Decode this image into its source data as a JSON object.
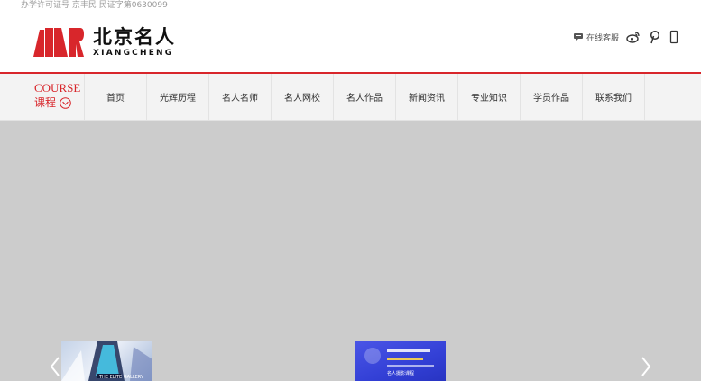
{
  "top_bar": {
    "license": "办学许可证号 京丰民 民证字第0630099"
  },
  "logo": {
    "cn": "北京名人",
    "en": "XIANGCHENG"
  },
  "header": {
    "service_label": "在线客服",
    "icons": [
      "chat-icon",
      "weibo-icon",
      "pinterest-icon",
      "mobile-icon"
    ]
  },
  "course": {
    "en": "COURSE",
    "cn": "课程"
  },
  "nav": {
    "items": [
      "首页",
      "光辉历程",
      "名人名师",
      "名人网校",
      "名人作品",
      "新闻资讯",
      "专业知识",
      "学员作品",
      "联系我们"
    ]
  },
  "banner": {
    "thumb1_caption": "THE ELITE GALLERY",
    "thumb2_caption": "名人摄影课程"
  },
  "colors": {
    "accent": "#d8262b",
    "nav_bg": "#f3f3f3",
    "banner_bg": "#cccccc"
  }
}
